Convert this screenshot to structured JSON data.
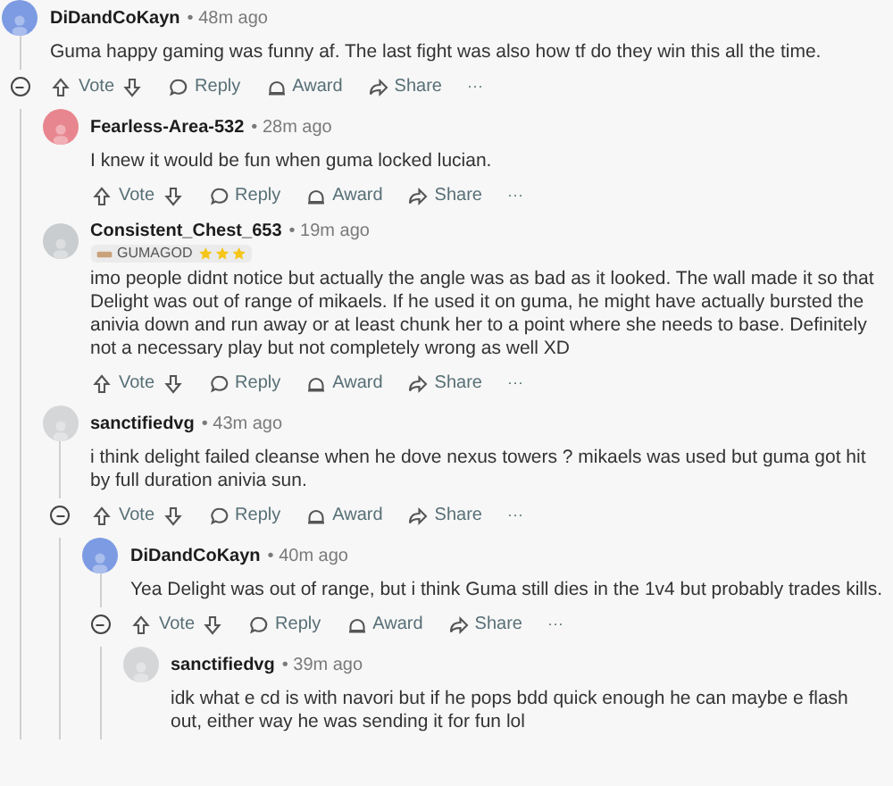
{
  "comments": [
    {
      "author": "DiDandCoKayn",
      "time": "• 48m ago",
      "color": "#7d9be3",
      "body": "Guma happy gaming was funny af. The last fight was also how tf do they win this all the time.",
      "expanded": true,
      "actions": [
        {
          "kind": "vote",
          "label": "Vote"
        },
        {
          "kind": "reply",
          "label": "Reply"
        },
        {
          "kind": "award",
          "label": "Award"
        },
        {
          "kind": "share",
          "label": "Share"
        },
        {
          "kind": "more",
          "label": "···"
        }
      ],
      "children": [
        {
          "author": "Fearless-Area-532",
          "time": "• 28m ago",
          "color": "#e8868f",
          "body": "I knew it would be fun when guma locked lucian.",
          "actions": [
            {
              "kind": "vote",
              "label": "Vote"
            },
            {
              "kind": "reply",
              "label": "Reply"
            },
            {
              "kind": "award",
              "label": "Award"
            },
            {
              "kind": "share",
              "label": "Share"
            },
            {
              "kind": "more",
              "label": "···"
            }
          ]
        },
        {
          "author": "Consistent_Chest_653",
          "time": "• 19m ago",
          "color": "#c9cdd0",
          "flair": "GUMAGOD",
          "body": "imo people didnt notice but actually the angle was as bad as it looked. The wall made it so that Delight was out of range of mikaels. If he used it on guma, he might have actually bursted the anivia down and run away or at least chunk her to a point where she needs to base. Definitely not a necessary play but not completely wrong as well XD",
          "actions": [
            {
              "kind": "vote",
              "label": "Vote"
            },
            {
              "kind": "reply",
              "label": "Reply"
            },
            {
              "kind": "award",
              "label": "Award"
            },
            {
              "kind": "share",
              "label": "Share"
            },
            {
              "kind": "more",
              "label": "···"
            }
          ]
        },
        {
          "author": "sanctifiedvg",
          "time": "• 43m ago",
          "color": "#d4d6d8",
          "body": "i think delight failed cleanse when he dove nexus towers ? mikaels was used but guma got hit by full duration anivia sun.",
          "expanded": true,
          "actions": [
            {
              "kind": "vote",
              "label": "Vote"
            },
            {
              "kind": "reply",
              "label": "Reply"
            },
            {
              "kind": "award",
              "label": "Award"
            },
            {
              "kind": "share",
              "label": "Share"
            },
            {
              "kind": "more",
              "label": "···"
            }
          ],
          "children": [
            {
              "author": "DiDandCoKayn",
              "time": "• 40m ago",
              "color": "#7d9be3",
              "body": "Yea Delight was out of range, but i think Guma still dies in the 1v4 but probably trades kills.",
              "expanded": true,
              "actions": [
                {
                  "kind": "vote",
                  "label": "Vote"
                },
                {
                  "kind": "reply",
                  "label": "Reply"
                },
                {
                  "kind": "award",
                  "label": "Award"
                },
                {
                  "kind": "share",
                  "label": "Share"
                },
                {
                  "kind": "more",
                  "label": "···"
                }
              ],
              "children": [
                {
                  "author": "sanctifiedvg",
                  "time": "• 39m ago",
                  "color": "#d4d6d8",
                  "body": "idk what e cd is with navori but if he pops bdd quick enough he can maybe e flash out, either way he was sending it for fun lol"
                }
              ]
            }
          ]
        }
      ]
    }
  ]
}
